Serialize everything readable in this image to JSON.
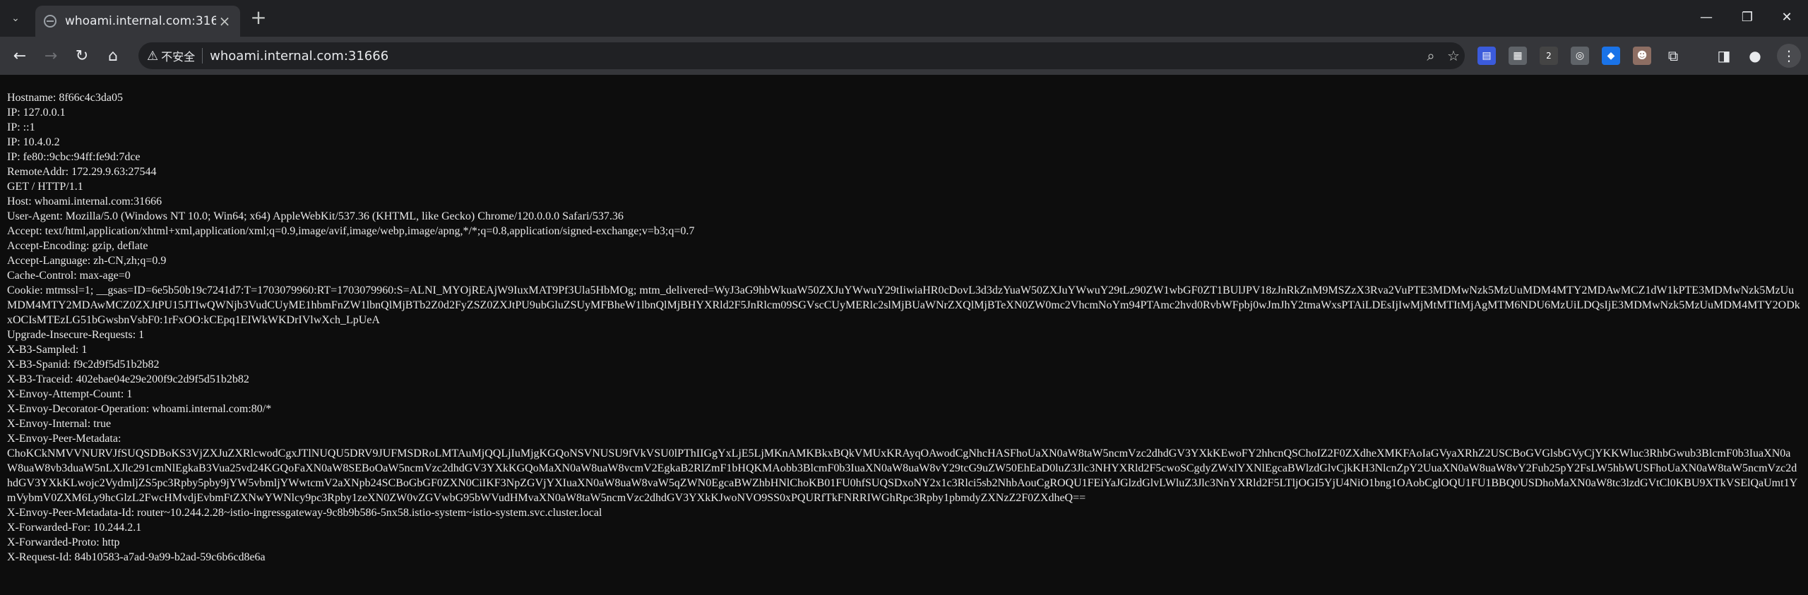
{
  "tab": {
    "title": "whoami.internal.com:31666"
  },
  "omnibox": {
    "security_label": "不安全",
    "url": "whoami.internal.com:31666"
  },
  "extensions": [
    "extension-icon-1",
    "extension-icon-2",
    "extension-icon-3",
    "extension-icon-4",
    "extension-icon-5",
    "extension-icon-6",
    "extension-icon-7"
  ],
  "badge_count": "2",
  "lines": [
    "Hostname: 8f66c4c3da05",
    "IP: 127.0.0.1",
    "IP: ::1",
    "IP: 10.4.0.2",
    "IP: fe80::9cbc:94ff:fe9d:7dce",
    "RemoteAddr: 172.29.9.63:27544",
    "GET / HTTP/1.1",
    "Host: whoami.internal.com:31666",
    "User-Agent: Mozilla/5.0 (Windows NT 10.0; Win64; x64) AppleWebKit/537.36 (KHTML, like Gecko) Chrome/120.0.0.0 Safari/537.36",
    "Accept: text/html,application/xhtml+xml,application/xml;q=0.9,image/avif,image/webp,image/apng,*/*;q=0.8,application/signed-exchange;v=b3;q=0.7",
    "Accept-Encoding: gzip, deflate",
    "Accept-Language: zh-CN,zh;q=0.9",
    "Cache-Control: max-age=0"
  ],
  "cookie": "Cookie: mtmssl=1; __gsas=ID=6e5b50b19c7241d7:T=1703079960:RT=1703079960:S=ALNI_MYOjREAjW9IuxMAT9Pf3Ula5HbMOg; mtm_delivered=WyJ3aG9hbWkuaW50ZXJuYWwuY29tIiwiaHR0cDovL3d3dzYuaW50ZXJuYWwuY29tLz90ZW1wbGF0ZT1BUlJPV18zJnRkZnM9MSZzX3Rva2VuPTE3MDMwNzk5MzUuMDM4MTY2MDAwMCZ1dW1kPTE3MDMwNzk5MzUuMDM4MTY2MDAwMCZ0ZXJtPU15JTIwQWNjb3VudCUyME1hbmFnZW1lbnQlMjBTb2Z0d2FyZSZ0ZXJtPU9ubGluZSUyMFBheW1lbnQlMjBHYXRld2F5JnRlcm09SGVscCUyMERlc2slMjBUaWNrZXQlMjBTeXN0ZW0mc2VhcmNoYm94PTAmc2hvd0RvbWFpbj0wJmJhY2tmaWxsPTAiLDEsIjIwMjMtMTItMjAgMTM6NDU6MzUiLDQsIjE3MDMwNzk5MzUuMDM4MTY2ODkxOCIsMTEzLG51bGwsbnVsbF0:1rFxOO:kCEpq1EIWkWKDrIVlwXch_LpUeA",
  "lines2": [
    "Upgrade-Insecure-Requests: 1",
    "X-B3-Sampled: 1",
    "X-B3-Spanid: f9c2d9f5d51b2b82",
    "X-B3-Traceid: 402ebae04e29e200f9c2d9f5d51b2b82",
    "X-Envoy-Attempt-Count: 1",
    "X-Envoy-Decorator-Operation: whoami.internal.com:80/*",
    "X-Envoy-Internal: true",
    "X-Envoy-Peer-Metadata:"
  ],
  "peer_metadata": "ChoKCkNMVVNURVJfSUQSDBoKS3VjZXJuZXRlcwodCgxJTlNUQU5DRV9JUFMSDRoLMTAuMjQQLjIuMjgKGQoNSVNUSU9fVkVSU0lPThIIGgYxLjE5LjMKnAMKBkxBQkVMUxKRAyqOAwodCgNhcHASFhoUaXN0aW8taW5ncmVzc2dhdGV3YXkKEwoFY2hhcnQSChoIZ2F0ZXdheXMKFAoIaGVyaXRhZ2USCBoGVGlsbGVyCjYKKWluc3RhbGwub3BlcmF0b3IuaXN0aW8uaW8vb3duaW5nLXJlc291cmNlEgkaB3Vua25vd24KGQoFaXN0aW8SEBoOaW5ncmVzc2dhdGV3YXkKGQoMaXN0aW8uaW8vcmV2EgkaB2RlZmF1bHQKMAobb3BlcmF0b3IuaXN0aW8uaW8vY29tcG9uZW50EhEaD0luZ3Jlc3NHYXRld2F5cwoSCgdyZWxlYXNlEgcaBWlzdGlvCjkKH3NlcnZpY2UuaXN0aW8uaW8vY2Fub25pY2FsLW5hbWUSFhoUaXN0aW8taW5ncmVzc2dhdGV3YXkKLwojc2VydmljZS5pc3Rpby5pby9jYW5vbmljYWwtcmV2aXNpb24SCBoGbGF0ZXN0CiIKF3NpZGVjYXIuaXN0aW8uaW8vaW5qZWN0EgcaBWZhbHNlChoKB01FU0hfSUQSDxoNY2x1c3Rlci5sb2NhbAouCgROQU1FEiYaJGlzdGlvLWluZ3Jlc3NnYXRld2F5LTljOGI5YjU4NiO1bng1OAobCglOQU1FU1BBQ0USDhoMaXN0aW8tc3lzdGVtCl0KBU9XTkVSElQaUmt1YmVybmV0ZXM6Ly9hcGlzL2FwcHMvdjEvbmFtZXNwYWNlcy9pc3Rpby1zeXN0ZW0vZGVwbG95bWVudHMvaXN0aW8taW5ncmVzc2dhdGV3YXkKJwoNVO9SS0xPQURfTkFNRRIWGhRpc3Rpby1pbmdyZXNzZ2F0ZXdheQ==",
  "lines3": [
    "X-Envoy-Peer-Metadata-Id: router~10.244.2.28~istio-ingressgateway-9c8b9b586-5nx58.istio-system~istio-system.svc.cluster.local",
    "X-Forwarded-For: 10.244.2.1",
    "X-Forwarded-Proto: http",
    "X-Request-Id: 84b10583-a7ad-9a99-b2ad-59c6b6cd8e6a"
  ]
}
